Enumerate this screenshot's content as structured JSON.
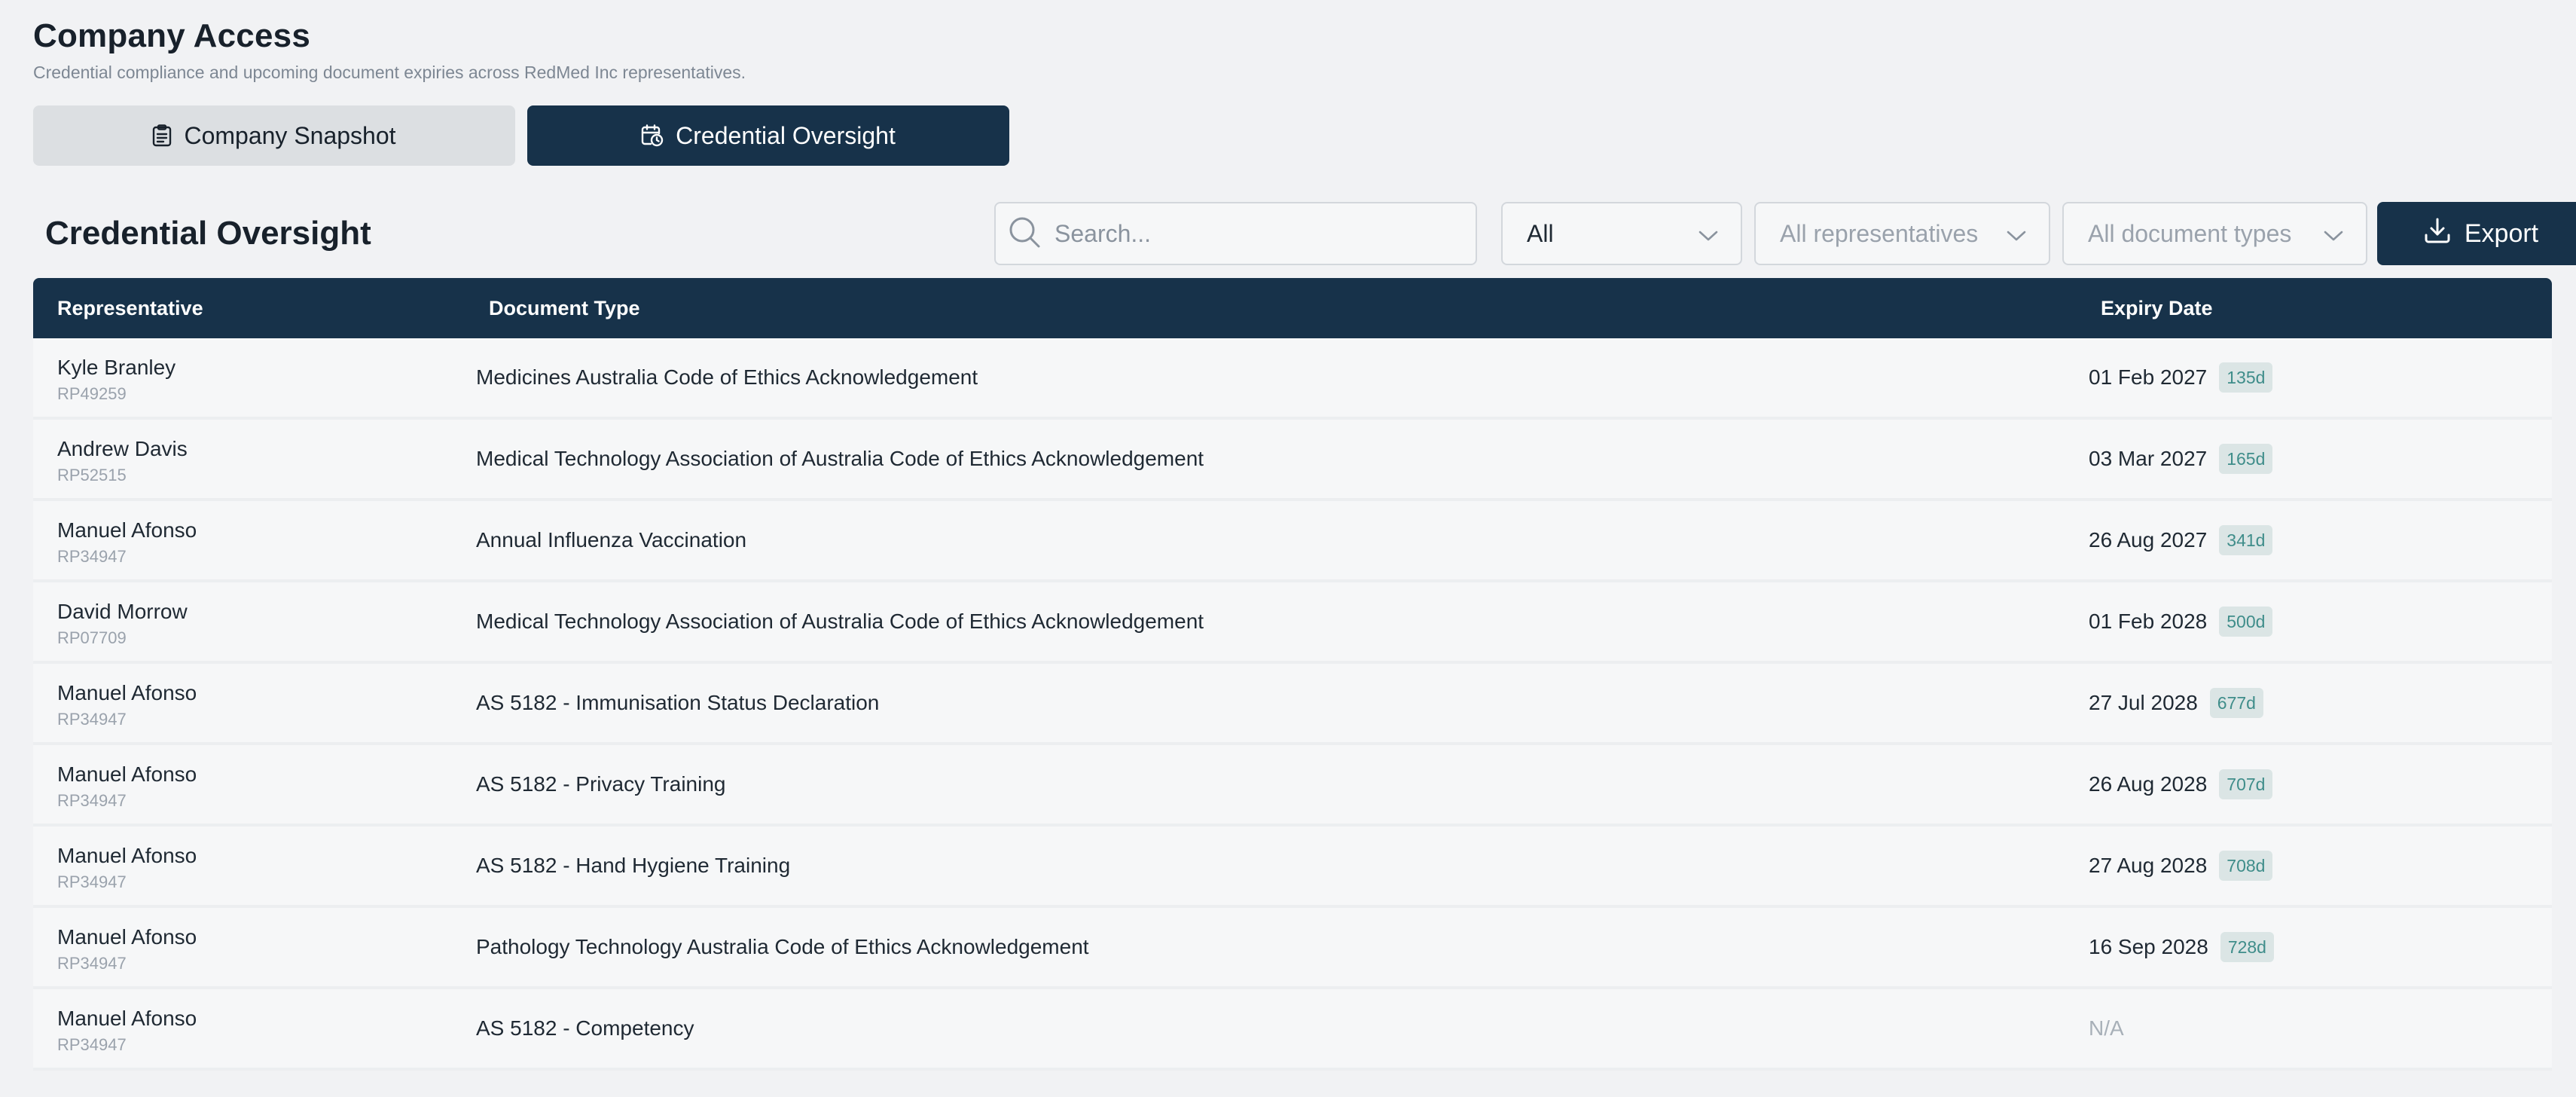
{
  "header": {
    "title": "Company Access",
    "subtitle": "Credential compliance and upcoming document expiries across RedMed Inc representatives."
  },
  "tabs": [
    {
      "label": "Company Snapshot",
      "active": false,
      "icon": "clipboard-icon"
    },
    {
      "label": "Credential Oversight",
      "active": true,
      "icon": "calendar-clock-icon"
    }
  ],
  "toolbar": {
    "section_title": "Credential Oversight",
    "search_placeholder": "Search...",
    "status_filter": "All",
    "representative_filter": "All representatives",
    "document_type_filter": "All document types",
    "export_label": "Export"
  },
  "table": {
    "columns": [
      "Representative",
      "Document Type",
      "Expiry Date"
    ],
    "rows": [
      {
        "name": "Kyle Branley",
        "id": "RP49259",
        "document": "Medicines Australia Code of Ethics Acknowledgement",
        "expiry": "01 Feb 2027",
        "days": "135d"
      },
      {
        "name": "Andrew Davis",
        "id": "RP52515",
        "document": "Medical Technology Association of Australia Code of Ethics Acknowledgement",
        "expiry": "03 Mar 2027",
        "days": "165d"
      },
      {
        "name": "Manuel Afonso",
        "id": "RP34947",
        "document": "Annual Influenza Vaccination",
        "expiry": "26 Aug 2027",
        "days": "341d"
      },
      {
        "name": "David Morrow",
        "id": "RP07709",
        "document": "Medical Technology Association of Australia Code of Ethics Acknowledgement",
        "expiry": "01 Feb 2028",
        "days": "500d"
      },
      {
        "name": "Manuel Afonso",
        "id": "RP34947",
        "document": "AS 5182 - Immunisation Status Declaration",
        "expiry": "27 Jul 2028",
        "days": "677d"
      },
      {
        "name": "Manuel Afonso",
        "id": "RP34947",
        "document": "AS 5182 - Privacy Training",
        "expiry": "26 Aug 2028",
        "days": "707d"
      },
      {
        "name": "Manuel Afonso",
        "id": "RP34947",
        "document": "AS 5182 - Hand Hygiene Training",
        "expiry": "27 Aug 2028",
        "days": "708d"
      },
      {
        "name": "Manuel Afonso",
        "id": "RP34947",
        "document": "Pathology Technology Australia Code of Ethics Acknowledgement",
        "expiry": "16 Sep 2028",
        "days": "728d"
      },
      {
        "name": "Manuel Afonso",
        "id": "RP34947",
        "document": "AS 5182 - Competency",
        "expiry": "N/A",
        "days": null
      }
    ]
  },
  "colors": {
    "primary": "#17324a",
    "background": "#f1f2f4",
    "badge_bg": "#dbe5e5",
    "badge_text": "#3f8d8a"
  }
}
